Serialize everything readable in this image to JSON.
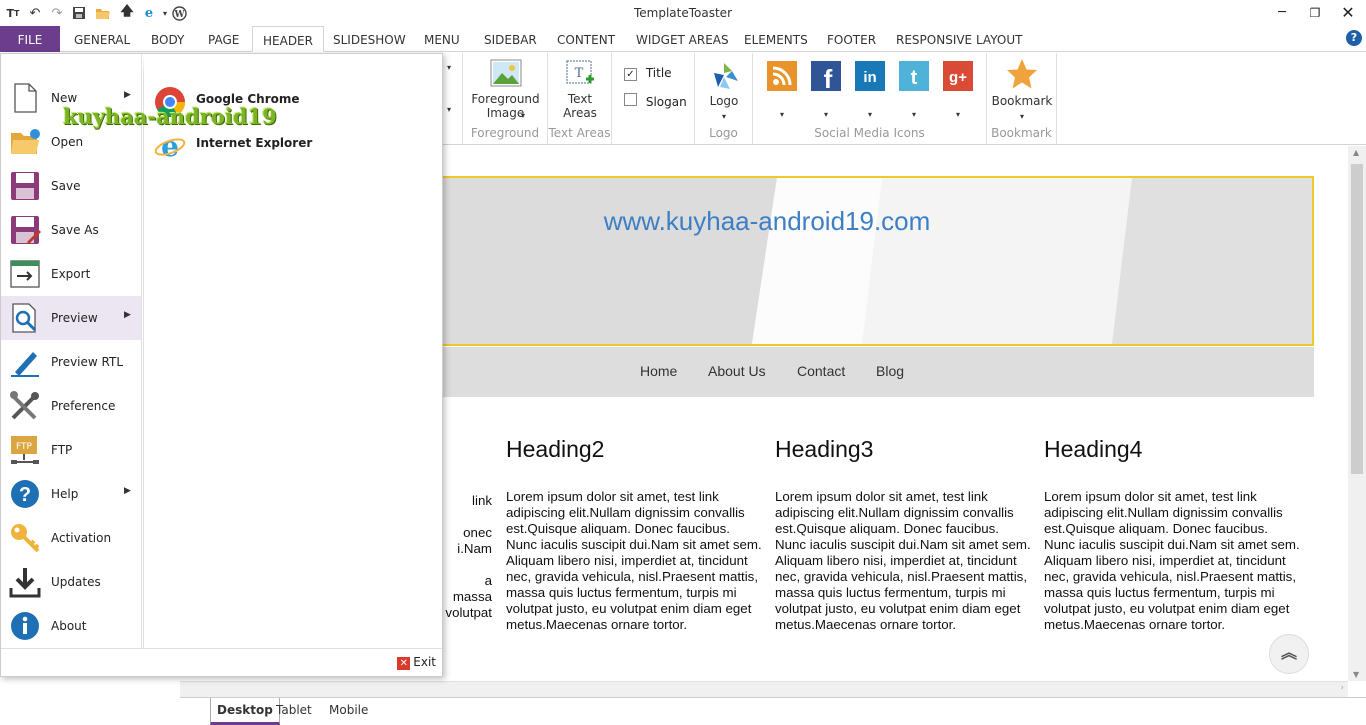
{
  "app": {
    "title": "TemplateToaster"
  },
  "quick_access": [
    "tt-icon",
    "undo-icon",
    "redo-icon",
    "save-icon",
    "open-folder-icon",
    "upload-icon",
    "ie-icon",
    "wordpress-icon"
  ],
  "menu_tabs": {
    "file": "FILE",
    "items": [
      "GENERAL",
      "BODY",
      "PAGE",
      "HEADER",
      "SLIDESHOW",
      "MENU",
      "SIDEBAR",
      "CONTENT",
      "WIDGET AREAS",
      "ELEMENTS",
      "FOOTER",
      "RESPONSIVE LAYOUT"
    ],
    "active": "HEADER"
  },
  "ribbon": {
    "foreground": {
      "button": "Foreground Image",
      "group": "Foreground"
    },
    "text_areas": {
      "button": "Text Areas",
      "group": "Text Areas"
    },
    "title_check": {
      "label": "Title",
      "checked": true
    },
    "slogan_check": {
      "label": "Slogan",
      "checked": false
    },
    "logo": {
      "button": "Logo",
      "group": "Logo"
    },
    "social": {
      "group": "Social Media Icons",
      "icons": [
        "rss-icon",
        "facebook-icon",
        "linkedin-icon",
        "tumblr-icon",
        "google-plus-icon"
      ]
    },
    "bookmark": {
      "button": "Bookmark",
      "group": "Bookmark"
    }
  },
  "file_menu": {
    "items": [
      {
        "label": "New",
        "icon": "new-file-icon",
        "submenu": true
      },
      {
        "label": "Open",
        "icon": "open-folder-icon",
        "submenu": false
      },
      {
        "label": "Save",
        "icon": "save-icon",
        "submenu": false
      },
      {
        "label": "Save As",
        "icon": "save-as-icon",
        "submenu": false
      },
      {
        "label": "Export",
        "icon": "export-icon",
        "submenu": false
      },
      {
        "label": "Preview",
        "icon": "preview-icon",
        "submenu": true
      },
      {
        "label": "Preview RTL",
        "icon": "preview-rtl-icon",
        "submenu": false
      },
      {
        "label": "Preference",
        "icon": "preference-icon",
        "submenu": false
      },
      {
        "label": "FTP",
        "icon": "ftp-icon",
        "submenu": false
      },
      {
        "label": "Help",
        "icon": "help-icon",
        "submenu": true
      },
      {
        "label": "Activation",
        "icon": "key-icon",
        "submenu": false
      },
      {
        "label": "Updates",
        "icon": "download-icon",
        "submenu": false
      },
      {
        "label": "About",
        "icon": "info-icon",
        "submenu": false
      }
    ],
    "submenu": [
      {
        "label": "Google Chrome",
        "icon": "chrome-icon"
      },
      {
        "label": "Internet Explorer",
        "icon": "ie-icon"
      }
    ],
    "exit": "Exit",
    "watermark": "kuyhaa-android19"
  },
  "canvas": {
    "site_title": "www.kuyhaa-android19.com",
    "nav": [
      "Home",
      "About Us",
      "Contact",
      "Blog"
    ],
    "partial_col": [
      "link",
      "onec",
      "i.Nam",
      "",
      "a",
      "massa",
      "volutpat"
    ],
    "columns": [
      {
        "heading": "Heading2",
        "text": "Lorem ipsum dolor sit amet, test link adipiscing elit.Nullam dignissim convallis est.Quisque aliquam. Donec faucibus. Nunc iaculis suscipit dui.Nam sit amet sem. Aliquam libero nisi, imperdiet at, tincidunt nec, gravida vehicula, nisl.Praesent mattis, massa quis luctus fermentum, turpis mi volutpat justo, eu volutpat enim diam eget metus.Maecenas ornare tortor."
      },
      {
        "heading": "Heading3",
        "text": "Lorem ipsum dolor sit amet, test link adipiscing elit.Nullam dignissim convallis est.Quisque aliquam. Donec faucibus. Nunc iaculis suscipit dui.Nam sit amet sem. Aliquam libero nisi, imperdiet at, tincidunt nec, gravida vehicula, nisl.Praesent mattis, massa quis luctus fermentum, turpis mi volutpat justo, eu volutpat enim diam eget metus.Maecenas ornare tortor."
      },
      {
        "heading": "Heading4",
        "text": "Lorem ipsum dolor sit amet, test link adipiscing elit.Nullam dignissim convallis est.Quisque aliquam. Donec faucibus. Nunc iaculis suscipit dui.Nam sit amet sem. Aliquam libero nisi, imperdiet at, tincidunt nec, gravida vehicula, nisl.Praesent mattis, massa quis luctus fermentum, turpis mi volutpat justo, eu volutpat enim diam eget metus.Maecenas ornare tortor."
      }
    ]
  },
  "device_tabs": {
    "items": [
      "Desktop",
      "Tablet",
      "Mobile"
    ],
    "active": "Desktop"
  },
  "colors": {
    "accent": "#6b3d8c",
    "header_border": "#f0c929",
    "site_title": "#3d7fc4"
  }
}
